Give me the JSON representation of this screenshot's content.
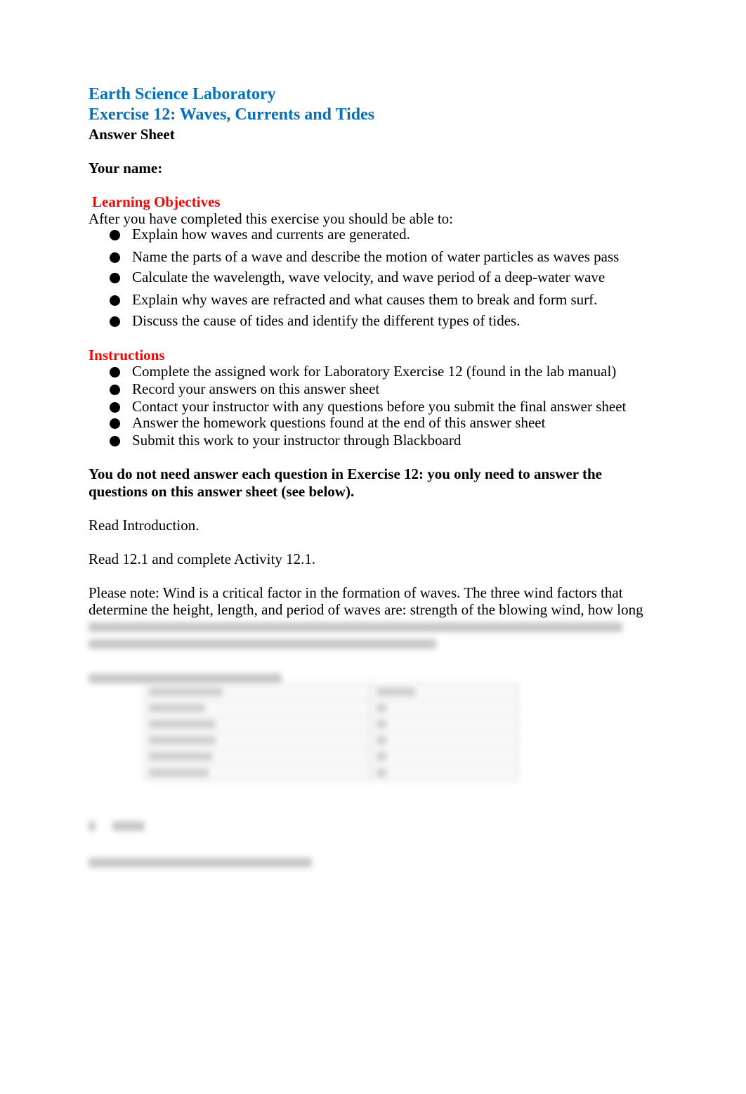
{
  "header": {
    "course_title": "Earth Science Laboratory",
    "exercise_title": "Exercise 12: Waves, Currents and Tides",
    "subtitle": "Answer Sheet"
  },
  "name_field": {
    "label": "Your name:",
    "value": ""
  },
  "learning_objectives": {
    "heading": "Learning Objectives",
    "intro": "After you have completed this exercise you should be able to:",
    "items": [
      "Explain how waves and currents are generated.",
      "Name the parts of a wave and describe the motion of water particles as waves pass",
      "Calculate the wavelength, wave velocity, and wave period of a deep-water wave",
      "Explain why waves are refracted and what causes them to break and form surf.",
      "Discuss the cause of tides and identify the different types of tides."
    ]
  },
  "instructions": {
    "heading": "Instructions",
    "items": [
      "Complete the assigned work for Laboratory Exercise 12 (found in the lab manual)",
      "Record your answers on this answer sheet",
      "Contact your instructor with any questions before you submit the final answer sheet",
      "Answer the homework questions found at the end of this answer sheet",
      "Submit this work to your instructor through Blackboard"
    ]
  },
  "notice": {
    "line1": "You do not need answer each question in Exercise 12: you only need to answer the",
    "line2": "questions on this answer sheet (see below)."
  },
  "steps": {
    "read_intro": "Read Introduction.",
    "read_12_1": "Read 12.1 and complete Activity 12.1."
  },
  "note": {
    "line1": "Please note: Wind is a critical factor in the formation of waves. The three wind factors that",
    "line2": "determine the height, length, and period of waves are: strength of the blowing wind, how long"
  },
  "colors": {
    "title_blue": "#0070C0",
    "heading_red": "#FF0000"
  }
}
